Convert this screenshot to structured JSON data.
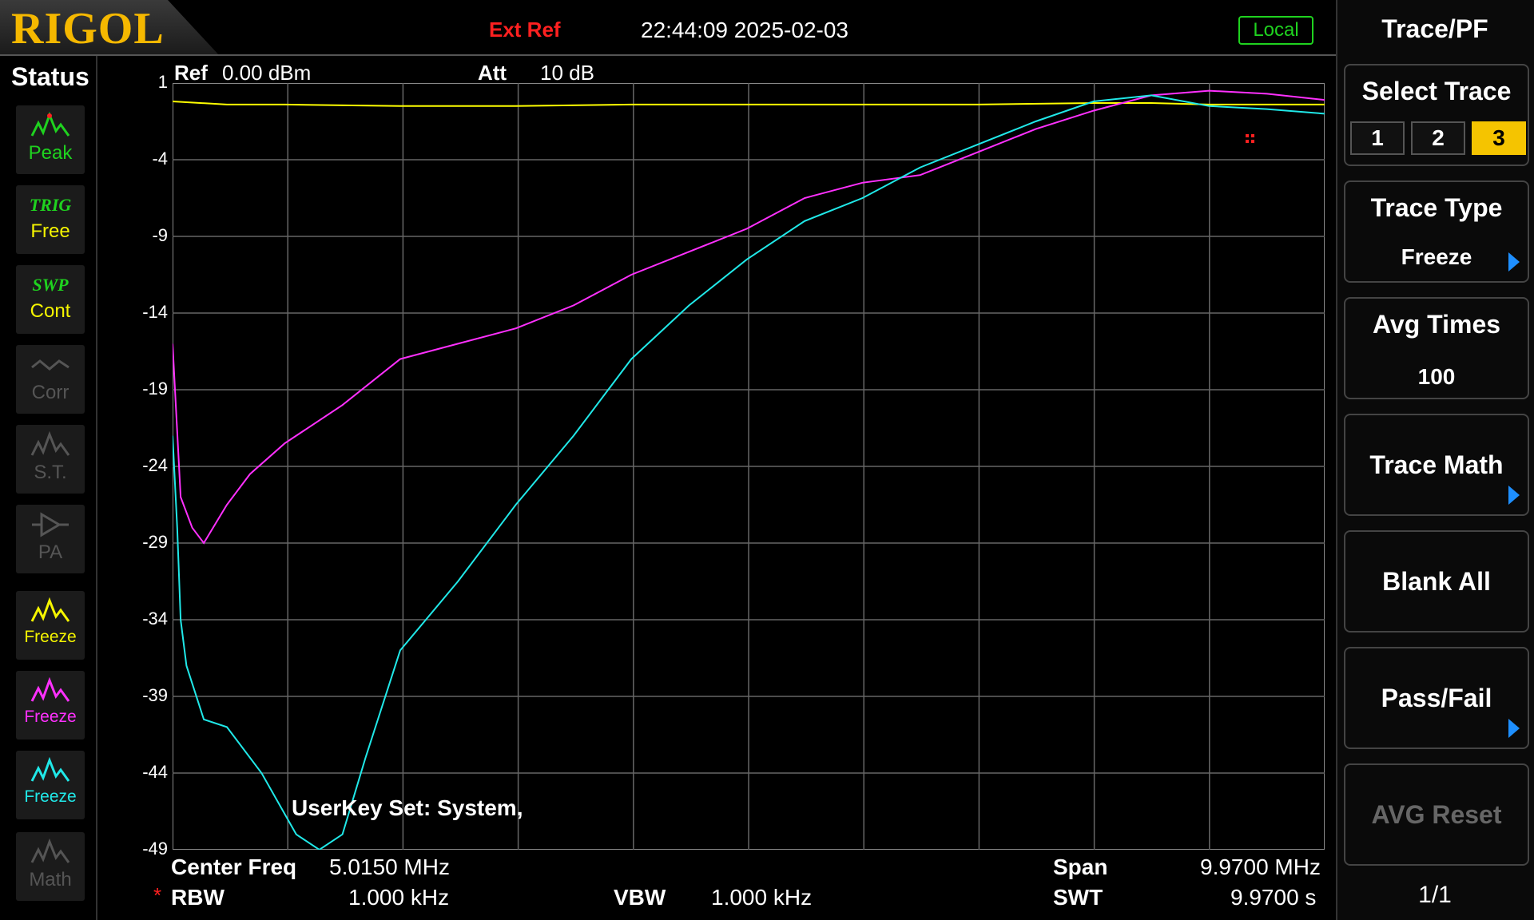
{
  "header": {
    "logo": "RIGOL",
    "ext_ref": "Ext Ref",
    "datetime": "22:44:09 2025-02-03",
    "mode": "Local"
  },
  "status_panel": {
    "title": "Status",
    "buttons": [
      {
        "label": "Peak",
        "tag": "",
        "icon": "peak-icon",
        "active": true
      },
      {
        "label": "Free",
        "tag": "TRIG",
        "icon": "",
        "active": true
      },
      {
        "label": "Cont",
        "tag": "SWP",
        "icon": "",
        "active": true
      },
      {
        "label": "Corr",
        "tag": "",
        "icon": "corr-icon",
        "active": false
      },
      {
        "label": "S.T.",
        "tag": "",
        "icon": "st-icon",
        "active": false
      },
      {
        "label": "PA",
        "tag": "",
        "icon": "pa-icon",
        "active": false
      },
      {
        "label": "Freeze",
        "tag": "",
        "icon": "trace1-icon",
        "active": true
      },
      {
        "label": "Freeze",
        "tag": "",
        "icon": "trace2-icon",
        "active": true
      },
      {
        "label": "Freeze",
        "tag": "",
        "icon": "trace3-icon",
        "active": true
      },
      {
        "label": "Math",
        "tag": "",
        "icon": "math-icon",
        "active": false
      }
    ]
  },
  "measurement": {
    "ref_label": "Ref",
    "ref_value": "0.00 dBm",
    "att_label": "Att",
    "att_value": "10 dB",
    "center_freq_label": "Center Freq",
    "center_freq_value": "5.0150 MHz",
    "span_label": "Span",
    "span_value": "9.9700 MHz",
    "rbw_marker": "*",
    "rbw_label": "RBW",
    "rbw_value": "1.000 kHz",
    "vbw_label": "VBW",
    "vbw_value": "1.000 kHz",
    "swt_label": "SWT",
    "swt_value": "9.9700 s",
    "userkey_text": "UserKey Set:    System,"
  },
  "chart_data": {
    "type": "line",
    "title": "",
    "xlabel": "",
    "ylabel": "",
    "xlim": [
      0.03,
      10.0
    ],
    "ylim": [
      -49,
      1
    ],
    "y_ticks": [
      "1",
      "-4",
      "-9",
      "-14",
      "-19",
      "-24",
      "-29",
      "-34",
      "-39",
      "-44",
      "-49"
    ],
    "x_divisions": 10,
    "grid": true,
    "series": [
      {
        "color": "#ffff00",
        "x": [
          0.03,
          0.5,
          1,
          2,
          3,
          4,
          5,
          6,
          7,
          8,
          8.5,
          9,
          9.5,
          10
        ],
        "y": [
          -0.2,
          -0.4,
          -0.4,
          -0.5,
          -0.5,
          -0.4,
          -0.4,
          -0.4,
          -0.4,
          -0.3,
          -0.3,
          -0.4,
          -0.4,
          -0.4
        ]
      },
      {
        "color": "#ff30ff",
        "x": [
          0.03,
          0.1,
          0.2,
          0.3,
          0.5,
          0.7,
          1,
          1.5,
          2,
          2.5,
          3,
          3.5,
          4,
          4.5,
          5,
          5.5,
          6,
          6.5,
          7,
          7.5,
          8,
          8.5,
          9,
          9.5,
          10
        ],
        "y": [
          -16,
          -26,
          -28,
          -29,
          -26.5,
          -24.5,
          -22.5,
          -20,
          -17,
          -16,
          -15,
          -13.5,
          -11.5,
          -10,
          -8.5,
          -6.5,
          -5.5,
          -5,
          -3.5,
          -2,
          -0.8,
          0.2,
          0.5,
          0.3,
          -0.1
        ]
      },
      {
        "color": "#20e8e8",
        "x": [
          0.03,
          0.07,
          0.1,
          0.15,
          0.3,
          0.5,
          0.8,
          1.1,
          1.3,
          1.5,
          1.7,
          2,
          2.5,
          3,
          3.5,
          4,
          4.5,
          5,
          5.5,
          6,
          6.5,
          7,
          7.5,
          8,
          8.5,
          9,
          9.5,
          10
        ],
        "y": [
          -22,
          -28,
          -34,
          -37,
          -40.5,
          -41,
          -44,
          -48,
          -49,
          -48,
          -43,
          -36,
          -31.5,
          -26.5,
          -22,
          -17,
          -13.5,
          -10.5,
          -8,
          -6.5,
          -4.5,
          -3,
          -1.5,
          -0.2,
          0.2,
          -0.5,
          -0.7,
          -1
        ]
      }
    ]
  },
  "right_panel": {
    "title": "Trace/PF",
    "select_trace_label": "Select Trace",
    "trace_buttons": [
      "1",
      "2",
      "3"
    ],
    "selected_trace": "3",
    "trace_type_label": "Trace Type",
    "trace_type_value": "Freeze",
    "avg_times_label": "Avg Times",
    "avg_times_value": "100",
    "trace_math_label": "Trace Math",
    "blank_all_label": "Blank All",
    "pass_fail_label": "Pass/Fail",
    "avg_reset_label": "AVG Reset",
    "page": "1/1"
  }
}
